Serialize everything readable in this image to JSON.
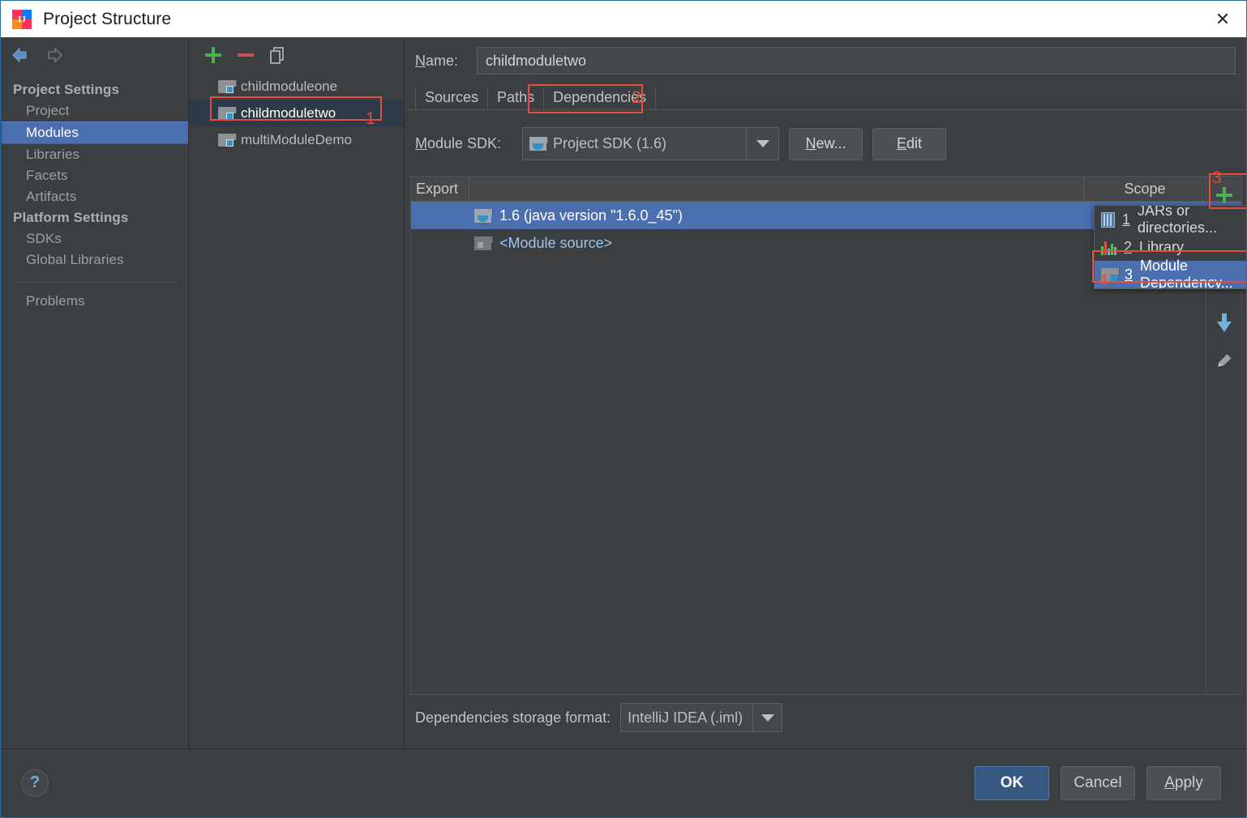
{
  "window": {
    "title": "Project Structure",
    "close_label": "✕",
    "app_icon": "intellij-idea-icon"
  },
  "sidebar": {
    "back_icon": "arrow-left-icon",
    "forward_icon": "arrow-right-icon",
    "groups": [
      {
        "header": "Project Settings",
        "items": [
          {
            "label": "Project",
            "selected": false
          },
          {
            "label": "Modules",
            "selected": true
          },
          {
            "label": "Libraries",
            "selected": false
          },
          {
            "label": "Facets",
            "selected": false
          },
          {
            "label": "Artifacts",
            "selected": false
          }
        ]
      },
      {
        "header": "Platform Settings",
        "items": [
          {
            "label": "SDKs",
            "selected": false
          },
          {
            "label": "Global Libraries",
            "selected": false
          }
        ]
      }
    ],
    "problems_label": "Problems"
  },
  "modules_panel": {
    "toolbar": {
      "add_icon": "plus-icon",
      "remove_icon": "minus-icon",
      "copy_icon": "copy-icon"
    },
    "items": [
      {
        "label": "childmoduleone",
        "selected": false
      },
      {
        "label": "childmoduletwo",
        "selected": true
      },
      {
        "label": "multiModuleDemo",
        "selected": false
      }
    ]
  },
  "main": {
    "name_label": "Name:",
    "name_value": "childmoduletwo",
    "tabs": [
      {
        "label": "Sources",
        "active": false
      },
      {
        "label": "Paths",
        "active": false
      },
      {
        "label": "Dependencies",
        "active": true
      }
    ],
    "sdk_label": "Module SDK:",
    "sdk_value": "Project SDK (1.6)",
    "new_button": "New...",
    "edit_button": "Edit",
    "table": {
      "columns": [
        "Export",
        "",
        "Scope"
      ],
      "rows": [
        {
          "icon": "sdk-folder-icon",
          "text": "1.6 (java version \"1.6.0_45\")",
          "selected": true,
          "scope": ""
        },
        {
          "icon": "module-source-icon",
          "text": "<Module source>",
          "selected": false,
          "scope": ""
        }
      ]
    },
    "side_tools": [
      {
        "icon": "plus-icon",
        "name": "add-dependency-button"
      },
      {
        "icon": "arrow-down-icon",
        "name": "move-down-button"
      },
      {
        "icon": "pencil-icon",
        "name": "edit-dependency-button"
      }
    ],
    "storage_label": "Dependencies storage format:",
    "storage_value": "IntelliJ IDEA (.iml)"
  },
  "popup_menu": {
    "items": [
      {
        "mnemonic": "1",
        "label": "JARs or directories...",
        "icon": "jar-icon",
        "selected": false
      },
      {
        "mnemonic": "2",
        "label": "Library...",
        "icon": "library-icon",
        "selected": false
      },
      {
        "mnemonic": "3",
        "label": "Module Dependency...",
        "icon": "module-icon",
        "selected": true
      }
    ]
  },
  "annotations": [
    {
      "number": "1",
      "target": "childmoduletwo module row"
    },
    {
      "number": "2",
      "target": "Dependencies tab"
    },
    {
      "number": "3",
      "target": "add dependency plus button"
    },
    {
      "number": "4",
      "target": "Module Dependency menu item"
    }
  ],
  "footer": {
    "help_icon": "help-icon",
    "buttons": [
      {
        "label": "OK",
        "primary": true
      },
      {
        "label": "Cancel",
        "primary": false
      },
      {
        "label": "Apply",
        "primary": false
      }
    ]
  },
  "colors": {
    "panel_bg": "#3c3f41",
    "selection_blue": "#4b6eaf",
    "accent_red": "#e74c3c",
    "accent_green": "#4caf50",
    "link_blue": "#97c7f0"
  }
}
